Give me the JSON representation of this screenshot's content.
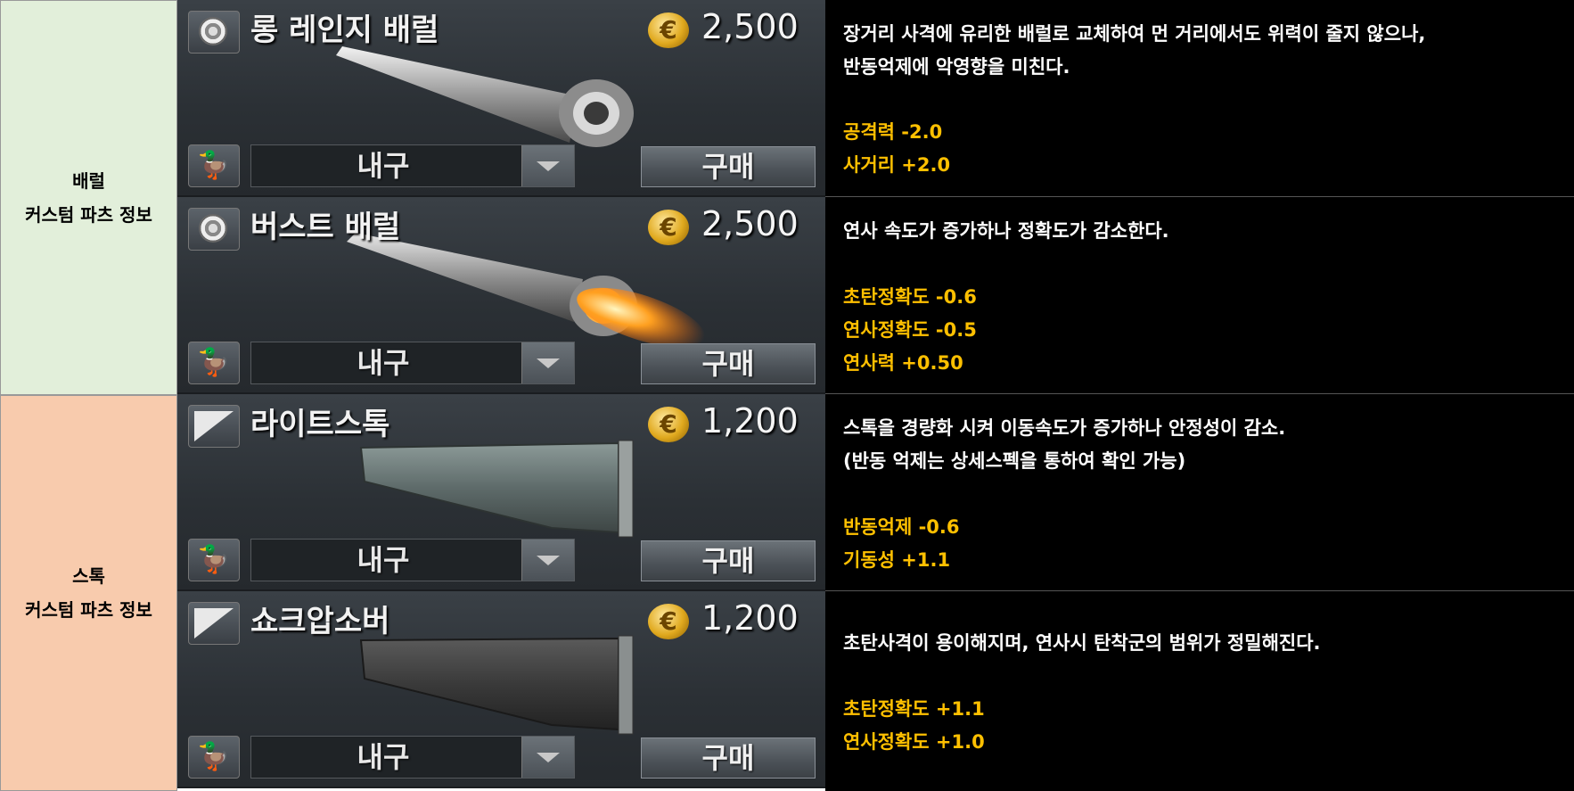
{
  "categories": [
    {
      "name": "배럴",
      "sub": "커스텀 파츠 정보"
    },
    {
      "name": "스톡",
      "sub": "커스텀 파츠 정보"
    }
  ],
  "items": [
    {
      "name": "롱 레인지 배럴",
      "icon": "barrel-ring-icon",
      "price": "2,500",
      "coin": "€",
      "durability_label": "내구",
      "buy_label": "구매",
      "desc": [
        "장거리 사격에 유리한 배럴로 교체하여 먼 거리에서도 위력이 줄지 않으나,",
        "반동억제에 악영향을 미친다."
      ],
      "stats": [
        "공격력 -2.0",
        "사거리 +2.0"
      ]
    },
    {
      "name": "버스트 배럴",
      "icon": "barrel-ring-icon",
      "price": "2,500",
      "coin": "€",
      "durability_label": "내구",
      "buy_label": "구매",
      "desc": [
        "연사 속도가 증가하나 정확도가 감소한다."
      ],
      "stats": [
        "초탄정확도 -0.6",
        "연사정확도 -0.5",
        "연사력 +0.50"
      ]
    },
    {
      "name": "라이트스톡",
      "icon": "stock-wedge-icon",
      "price": "1,200",
      "coin": "€",
      "durability_label": "내구",
      "buy_label": "구매",
      "desc": [
        "스톡을 경량화 시켜 이동속도가 증가하나 안정성이 감소.",
        "(반동 억제는 상세스펙을 통하여 확인 가능)"
      ],
      "stats": [
        "반동억제 -0.6",
        "기동성 +1.1"
      ]
    },
    {
      "name": "쇼크압소버",
      "icon": "stock-wedge-icon",
      "price": "1,200",
      "coin": "€",
      "durability_label": "내구",
      "buy_label": "구매",
      "desc": [
        "초탄사격이 용이해지며, 연사시 탄착군의 범위가 정밀해진다."
      ],
      "stats": [
        "초탄정확도 +1.1",
        "연사정확도 +1.0"
      ]
    }
  ],
  "colors": {
    "stat": "#ffc000",
    "barrel_bg": "#e2efda",
    "stock_bg": "#f8cbad"
  }
}
